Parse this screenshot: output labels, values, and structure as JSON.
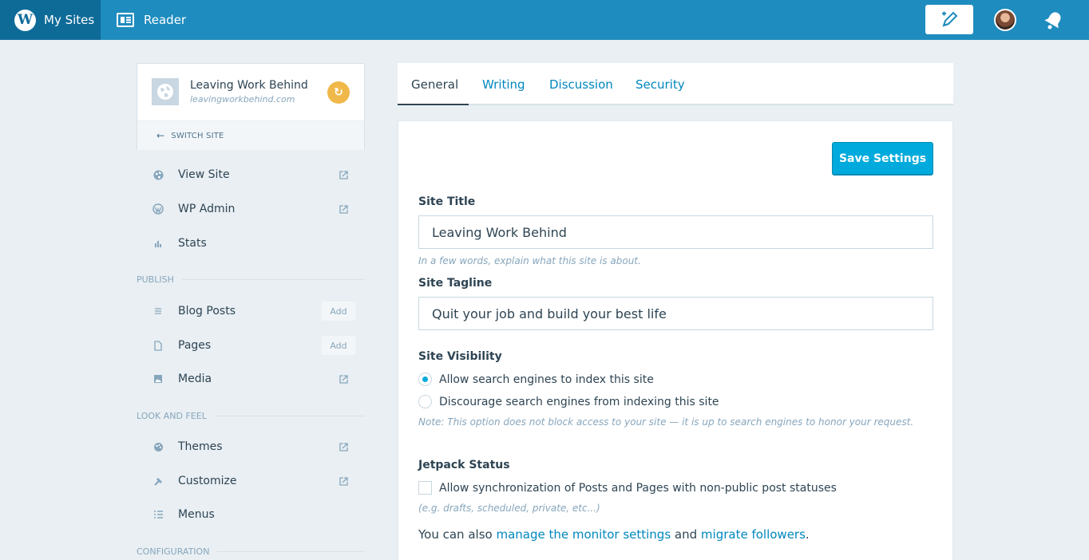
{
  "masterbar": {
    "my_sites": "My Sites",
    "reader": "Reader",
    "brand_color": "#1e8cbe"
  },
  "site": {
    "name": "Leaving Work Behind",
    "domain": "leavingworkbehind.com",
    "switch_label": "SWITCH SITE"
  },
  "sidebar": {
    "top_items": [
      {
        "label": "View Site",
        "icon": "globe-icon"
      },
      {
        "label": "WP Admin",
        "icon": "wordpress-icon"
      },
      {
        "label": "Stats",
        "icon": "stats-icon"
      }
    ],
    "publish_heading": "PUBLISH",
    "publish_items": [
      {
        "label": "Blog Posts",
        "icon": "posts-icon",
        "action": "Add"
      },
      {
        "label": "Pages",
        "icon": "page-icon",
        "action": "Add"
      },
      {
        "label": "Media",
        "icon": "media-icon"
      }
    ],
    "look_heading": "LOOK AND FEEL",
    "look_items": [
      {
        "label": "Themes",
        "icon": "themes-icon"
      },
      {
        "label": "Customize",
        "icon": "customize-icon"
      },
      {
        "label": "Menus",
        "icon": "menus-icon"
      }
    ],
    "config_heading": "CONFIGURATION"
  },
  "tabs": [
    {
      "label": "General",
      "active": true
    },
    {
      "label": "Writing"
    },
    {
      "label": "Discussion"
    },
    {
      "label": "Security"
    }
  ],
  "settings": {
    "save_label": "Save Settings",
    "site_title_label": "Site Title",
    "site_title_value": "Leaving Work Behind",
    "site_title_hint": "In a few words, explain what this site is about.",
    "tagline_label": "Site Tagline",
    "tagline_value": "Quit your job and build your best life",
    "visibility_label": "Site Visibility",
    "visibility_allow": "Allow search engines to index this site",
    "visibility_discourage": "Discourage search engines from indexing this site",
    "visibility_note": "Note: This option does not block access to your site — it is up to search engines to honor your request.",
    "jetpack_label": "Jetpack Status",
    "jetpack_sync": "Allow synchronization of Posts and Pages with non-public post statuses",
    "jetpack_hint": "(e.g. drafts, scheduled, private, etc...)",
    "also_prefix": "You can also ",
    "monitor_link": "manage the monitor settings",
    "and_text": " and ",
    "migrate_link": "migrate followers",
    "period": "."
  }
}
